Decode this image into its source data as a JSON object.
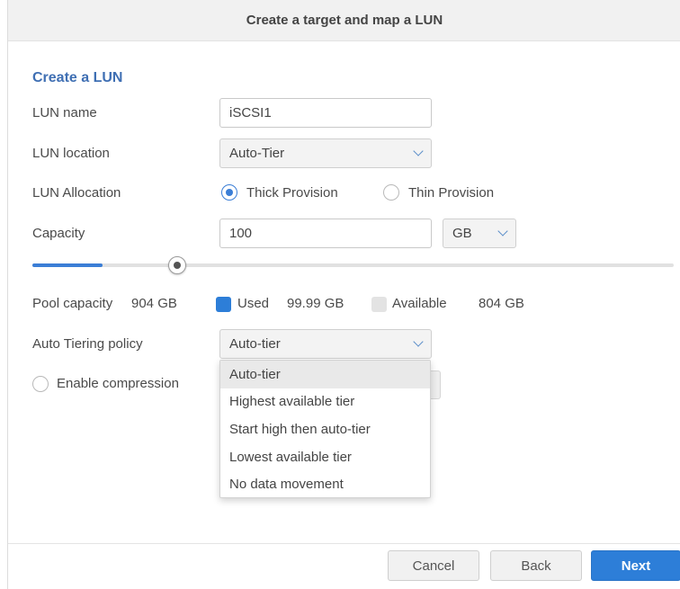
{
  "window": {
    "title": "Create a target and map a LUN"
  },
  "section": {
    "title": "Create a LUN"
  },
  "fields": {
    "lun_name": {
      "label": "LUN name",
      "value": "iSCSI1"
    },
    "lun_location": {
      "label": "LUN location",
      "value": "Auto-Tier"
    },
    "lun_allocation": {
      "label": "LUN Allocation",
      "options": [
        {
          "label": "Thick Provision",
          "selected": true
        },
        {
          "label": "Thin Provision",
          "selected": false
        }
      ]
    },
    "capacity": {
      "label": "Capacity",
      "value": "100",
      "unit": "GB",
      "slider_fraction": 0.11
    },
    "pool": {
      "label": "Pool capacity",
      "total": "904 GB",
      "used_label": "Used",
      "used_value": "99.99 GB",
      "available_label": "Available",
      "available_value": "804 GB",
      "used_color": "#2d7ed8",
      "available_color": "#e3e3e3"
    },
    "tiering_policy": {
      "label": "Auto Tiering policy",
      "value": "Auto-tier",
      "options": [
        "Auto-tier",
        "Highest available tier",
        "Start high then auto-tier",
        "Lowest available tier",
        "No data movement"
      ]
    },
    "compression": {
      "label": "Enable compression",
      "checked": false
    }
  },
  "buttons": {
    "cancel": "Cancel",
    "back": "Back",
    "next": "Next"
  },
  "colors": {
    "accent": "#2d7ed8",
    "section_title": "#3f6fb3"
  }
}
